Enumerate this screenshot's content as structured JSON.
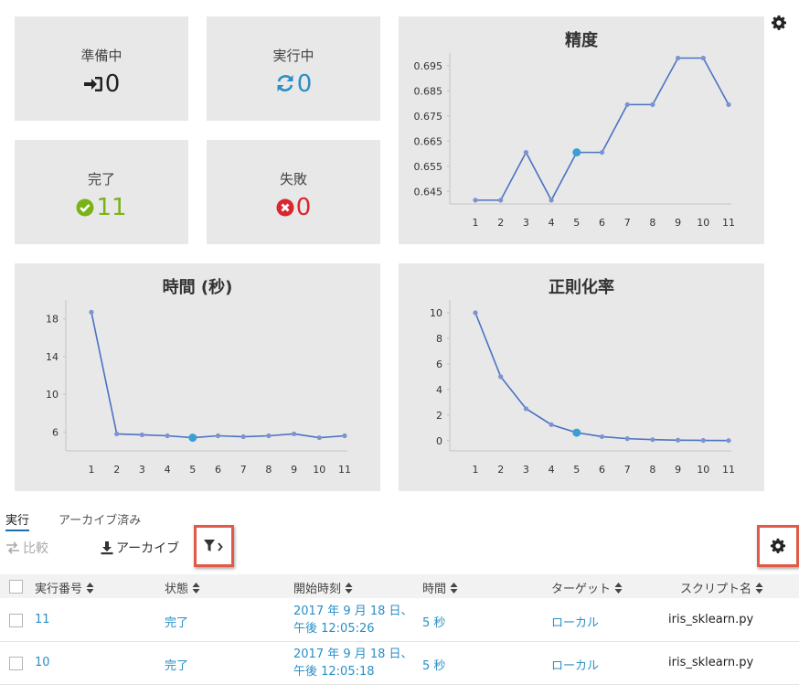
{
  "stats": [
    {
      "label": "準備中",
      "value": "0",
      "icon": "sign-in-icon",
      "color": "#222222"
    },
    {
      "label": "実行中",
      "value": "0",
      "icon": "refresh-icon",
      "color": "#2a8fc7"
    },
    {
      "label": "完了",
      "value": "11",
      "icon": "check-circle-icon",
      "color": "#7ab317"
    },
    {
      "label": "失敗",
      "value": "0",
      "icon": "x-circle-icon",
      "color": "#d9262f"
    }
  ],
  "chart_data": [
    {
      "type": "line",
      "title": "精度",
      "x": [
        1,
        2,
        3,
        4,
        5,
        6,
        7,
        8,
        9,
        10,
        11
      ],
      "series": [
        {
          "values": [
            0.6415,
            0.6415,
            0.6605,
            0.6415,
            0.6605,
            0.6605,
            0.6795,
            0.6795,
            0.698,
            0.698,
            0.6795
          ]
        }
      ],
      "highlight_index": 4,
      "ylim": [
        0.64,
        0.7
      ],
      "yticks": [
        "0.645",
        "0.655",
        "0.665",
        "0.675",
        "0.685",
        "0.695"
      ],
      "grid": false,
      "line_color": "#4a72c4"
    },
    {
      "type": "line",
      "title": "時間 (秒)",
      "x": [
        1,
        2,
        3,
        4,
        5,
        6,
        7,
        8,
        9,
        10,
        11
      ],
      "series": [
        {
          "values": [
            18.7,
            5.8,
            5.7,
            5.6,
            5.4,
            5.6,
            5.5,
            5.6,
            5.8,
            5.4,
            5.6
          ]
        }
      ],
      "highlight_index": 4,
      "ylim": [
        4,
        20
      ],
      "yticks": [
        "6",
        "10",
        "14",
        "18"
      ],
      "grid": false,
      "line_color": "#4a72c4"
    },
    {
      "type": "line",
      "title": "正則化率",
      "x": [
        1,
        2,
        3,
        4,
        5,
        6,
        7,
        8,
        9,
        10,
        11
      ],
      "series": [
        {
          "values": [
            10,
            5,
            2.5,
            1.25,
            0.625,
            0.3125,
            0.156,
            0.078,
            0.039,
            0.02,
            0.01
          ]
        }
      ],
      "highlight_index": 4,
      "ylim": [
        -0.8,
        11
      ],
      "yticks": [
        "0",
        "2",
        "4",
        "6",
        "8",
        "10"
      ],
      "grid": false,
      "line_color": "#4a72c4"
    }
  ],
  "tabs": {
    "runs": "実行",
    "archived": "アーカイブ済み"
  },
  "toolbar": {
    "compare": "比較",
    "archive": "アーカイブ"
  },
  "columns": [
    "実行番号",
    "状態",
    "開始時刻",
    "時間",
    "ターゲット",
    "スクリプト名"
  ],
  "rows": [
    {
      "run": "11",
      "status": "完了",
      "date": "2017 年 9 月 18 日、",
      "time": "午後 12:05:26",
      "duration": "5 秒",
      "target": "ローカル",
      "script": "iris_sklearn.py"
    },
    {
      "run": "10",
      "status": "完了",
      "date": "2017 年 9 月 18 日、",
      "time": "午後 12:05:18",
      "duration": "5 秒",
      "target": "ローカル",
      "script": "iris_sklearn.py"
    }
  ],
  "colors": {
    "card_bg": "#e8e8e8",
    "link": "#2a8fc7",
    "highlight_border": "#e05a47",
    "line": "#4a72c4"
  }
}
